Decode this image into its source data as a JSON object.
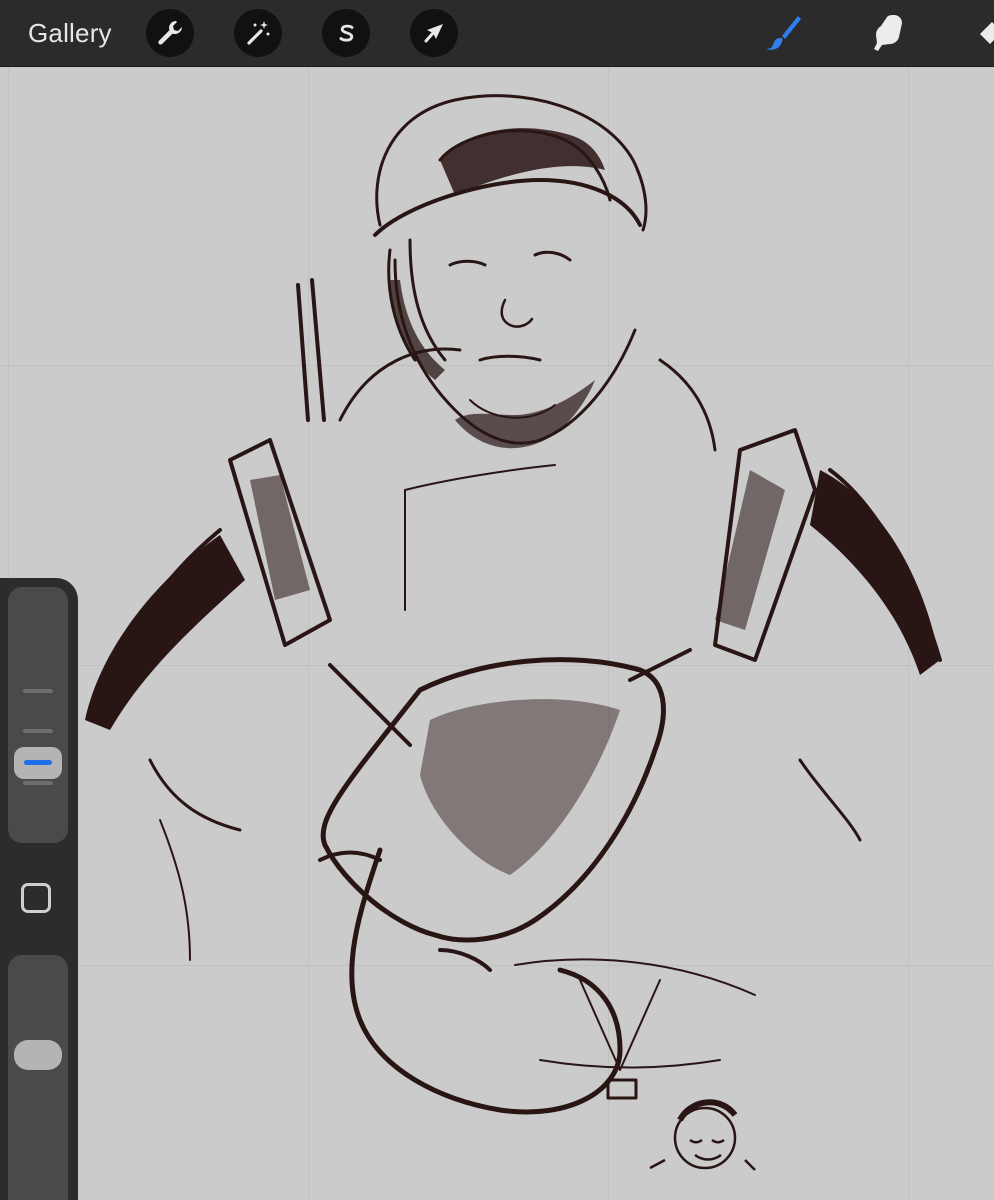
{
  "toolbar": {
    "gallery_label": "Gallery",
    "left_tools": [
      {
        "name": "actions",
        "icon": "wrench-icon"
      },
      {
        "name": "adjustments",
        "icon": "magic-wand-icon"
      },
      {
        "name": "selection",
        "icon": "selection-s-icon"
      },
      {
        "name": "transform",
        "icon": "arrow-cursor-icon"
      }
    ],
    "right_tools": [
      {
        "name": "brush",
        "icon": "paintbrush-icon",
        "active": true,
        "color": "#2f7ff0"
      },
      {
        "name": "smudge",
        "icon": "smudge-finger-icon",
        "active": false
      },
      {
        "name": "eraser",
        "icon": "eraser-icon",
        "active": false
      }
    ]
  },
  "sidebar": {
    "brush_size_level": 0.45,
    "opacity_level": 0.45,
    "modify_button_icon": "square-outline-icon"
  },
  "canvas": {
    "content": "pencil-sketch-illustration",
    "ink_color": "#2a1515",
    "paper_color": "#cbcbcb"
  }
}
